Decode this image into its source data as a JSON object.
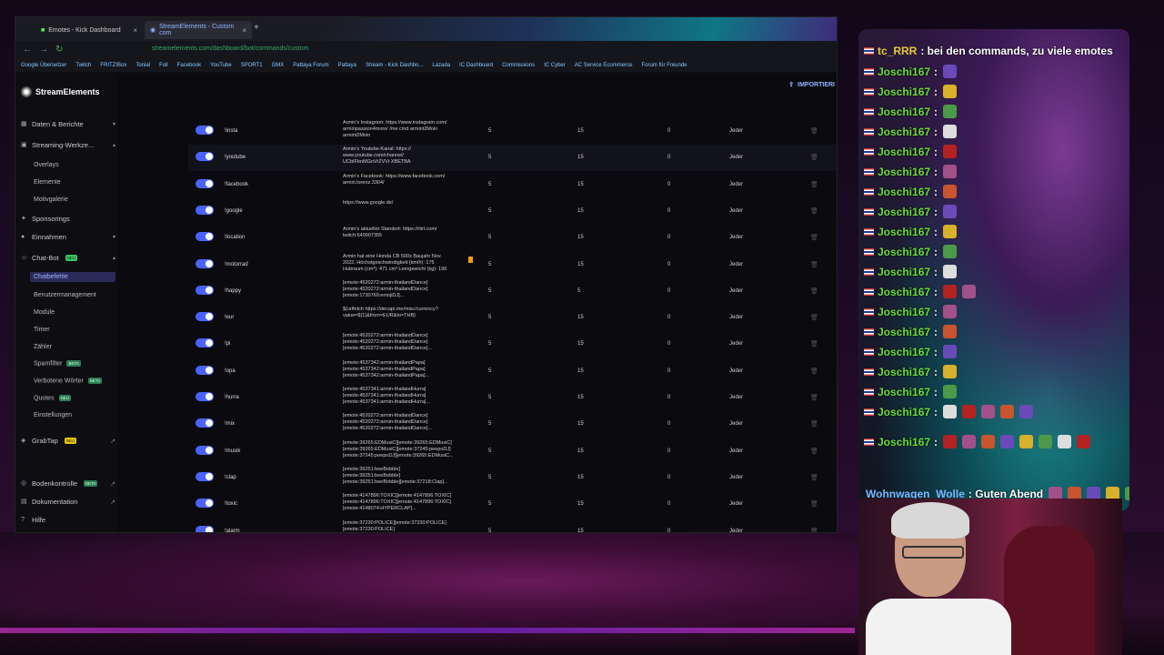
{
  "browser": {
    "tabs": [
      {
        "label": "Emotes - Kick Dashboard"
      },
      {
        "label": "StreamElements - Custom com"
      }
    ],
    "url": "streamelements.com/dashboard/bot/commands/custom",
    "bookmarks": [
      "Google Übersetzer",
      "Twitch",
      "FRITZ!Box",
      "Tonial",
      "Foll",
      "Facebook",
      "YouTube",
      "SPORT1",
      "GMX",
      "Pattaya Forum",
      "Pattaya",
      "Stream - Kick Dashbo...",
      "Lazada",
      "IC Dashboard",
      "Commissions",
      "IC Cyber",
      "AC Service Ecommerce",
      "Forum für Freunde"
    ]
  },
  "app": {
    "brand": "StreamElements",
    "import_label": "IMPORTIERI",
    "sidebar": {
      "sections": [
        {
          "label": "Daten & Berichte"
        },
        {
          "label": "Streaming-Werkze..."
        }
      ],
      "streaming_items": [
        "Overlays",
        "Elemente",
        "Motivgalerie"
      ],
      "sponsorings": "Sponsorings",
      "einnahmen": "Einnahmen",
      "chatbot": "Chat-Bot",
      "chatbot_badge": "NEU",
      "chatbot_items": [
        {
          "label": "Chatbefehle"
        },
        {
          "label": "Benutzermanagement"
        },
        {
          "label": "Module"
        },
        {
          "label": "Timer"
        },
        {
          "label": "Zähler"
        },
        {
          "label": "Spamfilter",
          "badge": "BETA"
        },
        {
          "label": "Verbotene Wörter",
          "badge": "BETA"
        },
        {
          "label": "Quotes",
          "badge": "NEU"
        },
        {
          "label": "Einstellungen"
        }
      ],
      "graptap": "GrabTap",
      "graptap_badge": "NEU",
      "bodenkontrolle": "Bodenkontrolle",
      "bodenkontrolle_badge": "BETA",
      "dokumentation": "Dokumentation",
      "hilfe": "Hilfe"
    },
    "commands": [
      {
        "name": "!insta",
        "response": "Armin's Instagram: https://www.instagram.com/\narminpassion4more/ /me cmd armint2Moin\narmint2Moin",
        "cooldown": "5",
        "user_cooldown": "15",
        "cost": "0",
        "level": "Jeder"
      },
      {
        "name": "!youtube",
        "response": "Armin's Youtube-Kanal: https://\nwww.youtube.com/channel/\nUCbIFbnMGnVrZVVi-XBETBA",
        "cooldown": "5",
        "user_cooldown": "15",
        "cost": "0",
        "level": "Jeder"
      },
      {
        "name": "!facebook",
        "response": "Armin's Facebook: https://www.facebook.com/\narmin.lorenz.3304/",
        "cooldown": "5",
        "user_cooldown": "15",
        "cost": "0",
        "level": "Jeder"
      },
      {
        "name": "!google",
        "response": "https://www.google.de/",
        "cooldown": "5",
        "user_cooldown": "15",
        "cost": "0",
        "level": "Jeder"
      },
      {
        "name": "!location",
        "response": "Armin's aktueller Standort: https://rtirl.com/\ntwitch:649907355",
        "cooldown": "5",
        "user_cooldown": "15",
        "cost": "0",
        "level": "Jeder"
      },
      {
        "name": "!motorrad",
        "response": "Armin hat eine Honda CB 500x Baujahr Nov.\n2022. Höchstgeschwindigkeit (km/h): 175\nHubraum (cm³): 471 cm³ Leergewicht (kg): 196",
        "cooldown": "5",
        "user_cooldown": "15",
        "cost": "0",
        "level": "Jeder"
      },
      {
        "name": "!happy",
        "response": "[emote:4520272:armin-thailandDance]\n[emote:4520272:armin-thailandDance]\n[emote:1730769:emojiDJ]...",
        "cooldown": "5",
        "user_cooldown": "5",
        "cost": "0",
        "level": "Jeder"
      },
      {
        "name": "!eur",
        "response": "${urlfetch https://decapi.me/misc/currency?\nvalue=${1}&from=EUR&to=THB}",
        "cooldown": "5",
        "user_cooldown": "15",
        "cost": "0",
        "level": "Jeder"
      },
      {
        "name": "!pi",
        "response": "[emote:4520272:armin-thailandDance]\n[emote:4520272:armin-thailandDance]\n[emote:4520272:armin-thailandDance]...",
        "cooldown": "5",
        "user_cooldown": "15",
        "cost": "0",
        "level": "Jeder"
      },
      {
        "name": "!opa",
        "response": "[emote:4537342:armin-thailandPapa]\n[emote:4537342:armin-thailandPapa]\n[emote:4537342:armin-thailandPapa]...",
        "cooldown": "5",
        "user_cooldown": "15",
        "cost": "0",
        "level": "Jeder"
      },
      {
        "name": "!hurra",
        "response": "[emote:4537341:armin-thailandHurra]\n[emote:4537341:armin-thailandHurra]\n[emote:4537341:armin-thailandHurra]...",
        "cooldown": "5",
        "user_cooldown": "15",
        "cost": "0",
        "level": "Jeder"
      },
      {
        "name": "!mix",
        "response": "[emote:4520272:armin-thailandDance]\n[emote:4520272:armin-thailandDance]\n[emote:4520272:armin-thailandDance]...",
        "cooldown": "5",
        "user_cooldown": "15",
        "cost": "0",
        "level": "Jeder"
      },
      {
        "name": "!musik",
        "response": "[emote:39265:EDMusiC][emote:39265:EDMusiC]\n[emote:39265:EDMusiC][emote:37245:peepoDJ]\n[emote:37245:peepoDJ][emote:39265:EDMusiC...",
        "cooldown": "5",
        "user_cooldown": "15",
        "cost": "0",
        "level": "Jeder"
      },
      {
        "name": "!clap",
        "response": "[emote:39251:beeBobble]\n[emote:39251:beeBobble]\n[emote:39251:beeBobble][emote:37218:Clap]...",
        "cooldown": "5",
        "user_cooldown": "15",
        "cost": "0",
        "level": "Jeder"
      },
      {
        "name": "!toxic",
        "response": "[emote:4147896:TOXIC][emote:4147896:TOXIC]\n[emote:4147896:TOXIC][emote:4147896:TOXIC]\n[emote:4148074:HYPERCLAP]...",
        "cooldown": "5",
        "user_cooldown": "15",
        "cost": "0",
        "level": "Jeder"
      },
      {
        "name": "!alarm",
        "response": "[emote:37230:POLICE][emote:37230:POLICE]\n[emote:37230:POLICE]\n[emote:4148144:catblobDance]...",
        "cooldown": "5",
        "user_cooldown": "15",
        "cost": "0",
        "level": "Jeder"
      }
    ]
  },
  "chat": {
    "messages": [
      {
        "user": "tc_RRR",
        "text": ": bei den commands, zu viele emotes"
      },
      {
        "user": "Joschi167",
        "text": ":"
      },
      {
        "user": "Joschi167",
        "text": ":"
      },
      {
        "user": "Joschi167",
        "text": ":"
      },
      {
        "user": "Joschi167",
        "text": ":"
      },
      {
        "user": "Joschi167",
        "text": ":"
      },
      {
        "user": "Joschi167",
        "text": ":"
      },
      {
        "user": "Joschi167",
        "text": ":"
      },
      {
        "user": "Joschi167",
        "text": ":"
      },
      {
        "user": "Joschi167",
        "text": ":"
      },
      {
        "user": "Joschi167",
        "text": ":"
      },
      {
        "user": "Joschi167",
        "text": ":"
      },
      {
        "user": "Joschi167",
        "text": ":"
      },
      {
        "user": "Joschi167",
        "text": ":"
      },
      {
        "user": "Joschi167",
        "text": ":"
      },
      {
        "user": "Joschi167",
        "text": ":"
      },
      {
        "user": "Joschi167",
        "text": ":"
      },
      {
        "user": "Joschi167",
        "text": ":"
      },
      {
        "user": "Joschi167",
        "text": ":"
      },
      {
        "user": "Joschi167",
        "text": ":"
      },
      {
        "user": "Wohnwagen_Wolle",
        "text": ": Guten Abend"
      }
    ]
  }
}
